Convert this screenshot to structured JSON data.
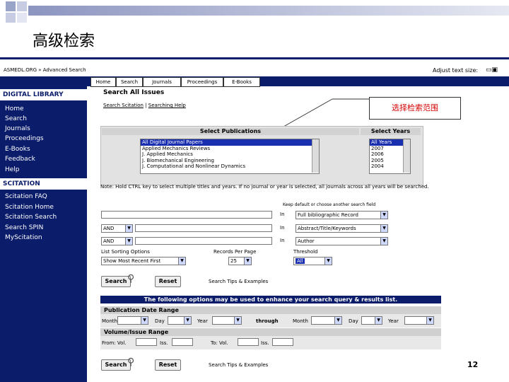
{
  "slide": {
    "title": "高级检索",
    "page_number": "12"
  },
  "callout": {
    "text": "选择检索范围"
  },
  "site": {
    "header": "ASMEDL.ORG » Advanced Search",
    "adjust_text_size": "Adjust text size:"
  },
  "tabs": [
    "Home",
    "Search",
    "Journals",
    "Proceedings",
    "E-Books"
  ],
  "sidebar": {
    "section1_title": "DIGITAL LIBRARY",
    "section1_items": [
      "Home",
      "Search",
      "Journals",
      "Proceedings",
      "E-Books",
      "Feedback",
      "Help"
    ],
    "section2_title": "SCITATION",
    "section2_items": [
      "Scitation FAQ",
      "Scitation Home",
      "Scitation Search",
      "Search SPIN",
      "MyScitation"
    ]
  },
  "main": {
    "title": "Search All Issues",
    "link1": "Search Scitation",
    "separator": "|",
    "link2": "Searching Help",
    "select_publications_label": "Select Publications",
    "select_years_label": "Select Years",
    "publications": [
      "All Digital Journal Papers",
      "Applied Mechanics Reviews",
      "J. Applied Mechanics",
      "J. Biomechanical Engineering",
      "J. Computational and Nonlinear Dynamics"
    ],
    "years": [
      "All Years",
      "2007",
      "2006",
      "2005",
      "2004"
    ],
    "note": "Note: Hold CTRL key to select multiple titles and years. If no journal or year is selected, all journals across all years will be searched.",
    "field_hint": "Keep default or choose another search field",
    "in_label": "In",
    "field_options": [
      "Full bibliographic Record",
      "Abstract/Title/Keywords",
      "Author"
    ],
    "bool_ops": [
      "AND",
      "AND"
    ],
    "sorting_label": "List Sorting Options",
    "sorting_value": "Show Most Recent First",
    "records_label": "Records Per Page",
    "records_value": "25",
    "threshold_label": "Threshold",
    "threshold_value": "All",
    "search_button": "Search",
    "reset_button": "Reset",
    "tips_link": "Search Tips & Examples",
    "options_banner": "The following options may be used to enhance your search query & results list.",
    "date_range_title": "Publication Date Range",
    "month_label": "Month",
    "day_label": "Day",
    "year_label": "Year",
    "through_label": "through",
    "volume_title": "Volume/Issue Range",
    "from_vol_label": "From: Vol.",
    "iss_label": "Iss.",
    "to_vol_label": "To: Vol.",
    "iss2_label": "Iss."
  },
  "colors": {
    "nav": "#0a1c6a",
    "callout_text": "#d40000",
    "selection": "#1a2fb0"
  }
}
